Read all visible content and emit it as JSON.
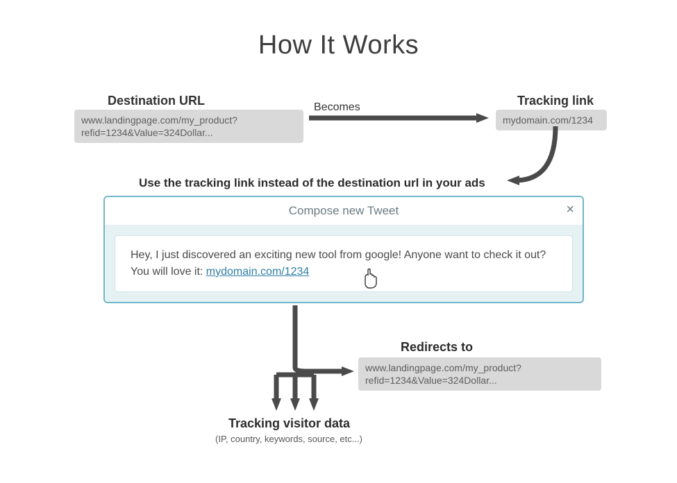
{
  "title": "How It Works",
  "destination": {
    "label": "Destination URL",
    "value": "www.landingpage.com/my_product?refid=1234&Value=324Dollar..."
  },
  "becomes_label": "Becomes",
  "tracking": {
    "label": "Tracking link",
    "value": "mydomain.com/1234"
  },
  "use_line": "Use the tracking link instead of the destination url in your ads",
  "tweet": {
    "header": "Compose new Tweet",
    "close": "×",
    "body_prefix": "Hey, I just discovered an exciting new tool from google! Anyone want to check it out? You will love it: ",
    "body_link": "mydomain.com/1234"
  },
  "redirects": {
    "label": "Redirects to",
    "value": "www.landingpage.com/my_product?refid=1234&Value=324Dollar..."
  },
  "tracking_visitor": {
    "title": "Tracking visitor data",
    "sub": "(IP, country, keywords, source, etc...)"
  }
}
